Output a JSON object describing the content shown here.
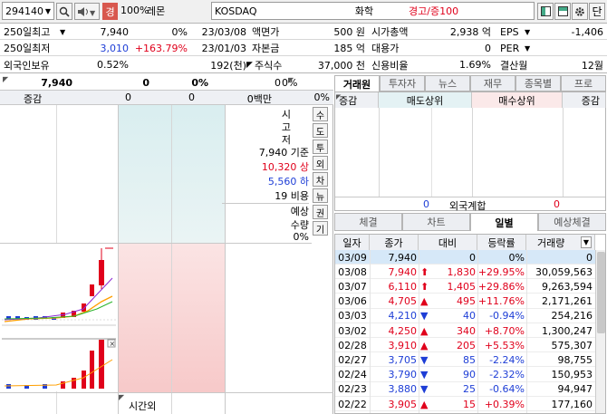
{
  "toolbar": {
    "code": "294140",
    "search_icon": "search-icon",
    "speaker_icon": "speaker-icon",
    "badge": "경",
    "margin": "100%",
    "name": "레몬",
    "market": "KOSDAQ",
    "sector": "화학",
    "warning": "경고/증100",
    "right_last": "단"
  },
  "info": {
    "r1": {
      "l1": "250일최고",
      "v1": "7,940",
      "p1": "0%",
      "d1": "23/03/08",
      "l2": "액면가",
      "v2": "500 원",
      "l3": "시가총액",
      "v3": "2,938 억",
      "l4": "EPS",
      "v4": "-1,406"
    },
    "r2": {
      "l1": "250일최저",
      "v1": "3,010",
      "p1": "+163.79%",
      "d1": "23/01/03",
      "l2": "자본금",
      "v2": "185 억",
      "l3": "대용가",
      "v3": "0",
      "l4": "PER",
      "v4": ""
    },
    "r3": {
      "l1": "외국인보유",
      "v1": "0.52%",
      "p1": "",
      "d1": "192(천)",
      "l2": "주식수",
      "v2": "37,000 천",
      "l3": "신용비율",
      "v3": "1.69%",
      "l4": "결산월",
      "v4": "12월"
    }
  },
  "quote": {
    "price": "7,940",
    "change": "0",
    "rate": "0%",
    "vol": "0",
    "vol_pct": "0%",
    "label_change": "증감",
    "c1": "0",
    "c2": "0",
    "amount": "0백만",
    "pct": "0%"
  },
  "side": {
    "vertical": [
      "시",
      "고",
      "저"
    ],
    "base": "7,940 기준",
    "upper": "10,320 상",
    "lower": "5,560 하",
    "ratio": "19 비용",
    "exp1": "예상",
    "exp2": "수량",
    "exp3": "0%",
    "btns": [
      "수",
      "도",
      "투",
      "외",
      "차",
      "뉴",
      "권",
      "기"
    ],
    "bottom_label": "시간외"
  },
  "broker": {
    "tabs": [
      "거래원",
      "투자자",
      "뉴스",
      "재무",
      "종목별",
      "프로"
    ],
    "headers": [
      "증감",
      "매도상위",
      "매수상위",
      "증감"
    ],
    "foot_left": "0",
    "foot_label": "외국계합",
    "foot_right": "0"
  },
  "daily": {
    "tabs": [
      "체결",
      "차트",
      "일별",
      "예상체결"
    ],
    "headers": [
      "일자",
      "종가",
      "대비",
      "등락률",
      "거래량"
    ],
    "rows": [
      {
        "date": "03/09",
        "close": "7,940",
        "arrow": "",
        "diff": "0",
        "rate": "0%",
        "vol": "0",
        "dir": "flat",
        "hl": true
      },
      {
        "date": "03/08",
        "close": "7,940",
        "arrow": "⬆",
        "diff": "1,830",
        "rate": "+29.95%",
        "vol": "30,059,563",
        "dir": "up",
        "hl": false
      },
      {
        "date": "03/07",
        "close": "6,110",
        "arrow": "⬆",
        "diff": "1,405",
        "rate": "+29.86%",
        "vol": "9,263,594",
        "dir": "up",
        "hl": false
      },
      {
        "date": "03/06",
        "close": "4,705",
        "arrow": "▲",
        "diff": "495",
        "rate": "+11.76%",
        "vol": "2,171,261",
        "dir": "up",
        "hl": false
      },
      {
        "date": "03/03",
        "close": "4,210",
        "arrow": "▼",
        "diff": "40",
        "rate": "-0.94%",
        "vol": "254,216",
        "dir": "down",
        "hl": false
      },
      {
        "date": "03/02",
        "close": "4,250",
        "arrow": "▲",
        "diff": "340",
        "rate": "+8.70%",
        "vol": "1,300,247",
        "dir": "up",
        "hl": false
      },
      {
        "date": "02/28",
        "close": "3,910",
        "arrow": "▲",
        "diff": "205",
        "rate": "+5.53%",
        "vol": "575,307",
        "dir": "up",
        "hl": false
      },
      {
        "date": "02/27",
        "close": "3,705",
        "arrow": "▼",
        "diff": "85",
        "rate": "-2.24%",
        "vol": "98,755",
        "dir": "down",
        "hl": false
      },
      {
        "date": "02/24",
        "close": "3,790",
        "arrow": "▼",
        "diff": "90",
        "rate": "-2.32%",
        "vol": "150,953",
        "dir": "down",
        "hl": false
      },
      {
        "date": "02/23",
        "close": "3,880",
        "arrow": "▼",
        "diff": "25",
        "rate": "-0.64%",
        "vol": "94,947",
        "dir": "down",
        "hl": false
      },
      {
        "date": "02/22",
        "close": "3,905",
        "arrow": "▲",
        "diff": "15",
        "rate": "+0.39%",
        "vol": "177,160",
        "dir": "up",
        "hl": false
      }
    ]
  },
  "colors": {
    "up": "#e0001b",
    "down": "#1e3ed6",
    "accent": "#2b5fa6"
  }
}
